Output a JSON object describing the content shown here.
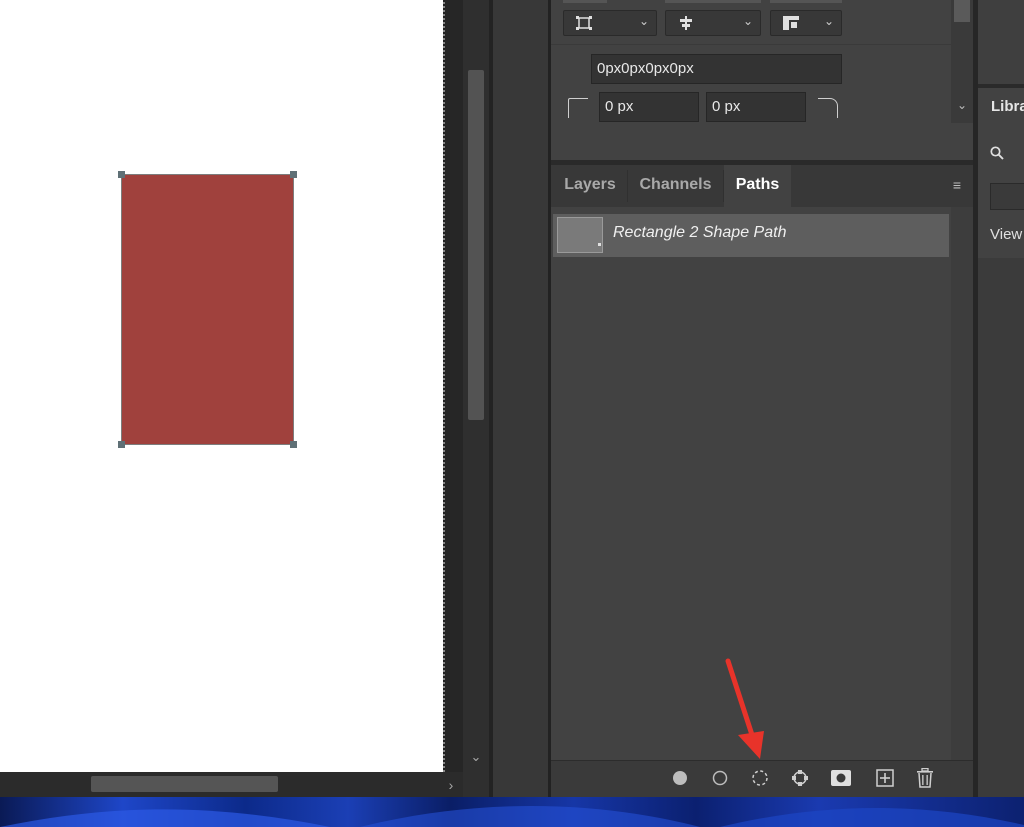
{
  "properties": {
    "corner_radii_text": "0px0px0px0px",
    "corner_left_value": "0 px",
    "corner_right_value": "0 px"
  },
  "paths_panel": {
    "tabs": [
      {
        "label": "Layers",
        "active": false
      },
      {
        "label": "Channels",
        "active": false
      },
      {
        "label": "Paths",
        "active": true
      }
    ],
    "items": [
      {
        "name": "Rectangle 2 Shape Path",
        "selected": true
      }
    ],
    "footer_icons": [
      "fill-path-icon",
      "stroke-path-icon",
      "load-path-as-selection-icon",
      "make-work-path-icon",
      "add-mask-icon",
      "new-path-icon",
      "delete-path-icon"
    ]
  },
  "libraries_panel": {
    "title": "Libra",
    "view_label": "View"
  },
  "canvas": {
    "shape_color": "#a0413d"
  },
  "annotation": {
    "arrow_color": "#e8332a",
    "points_to": "load-path-as-selection-icon"
  }
}
